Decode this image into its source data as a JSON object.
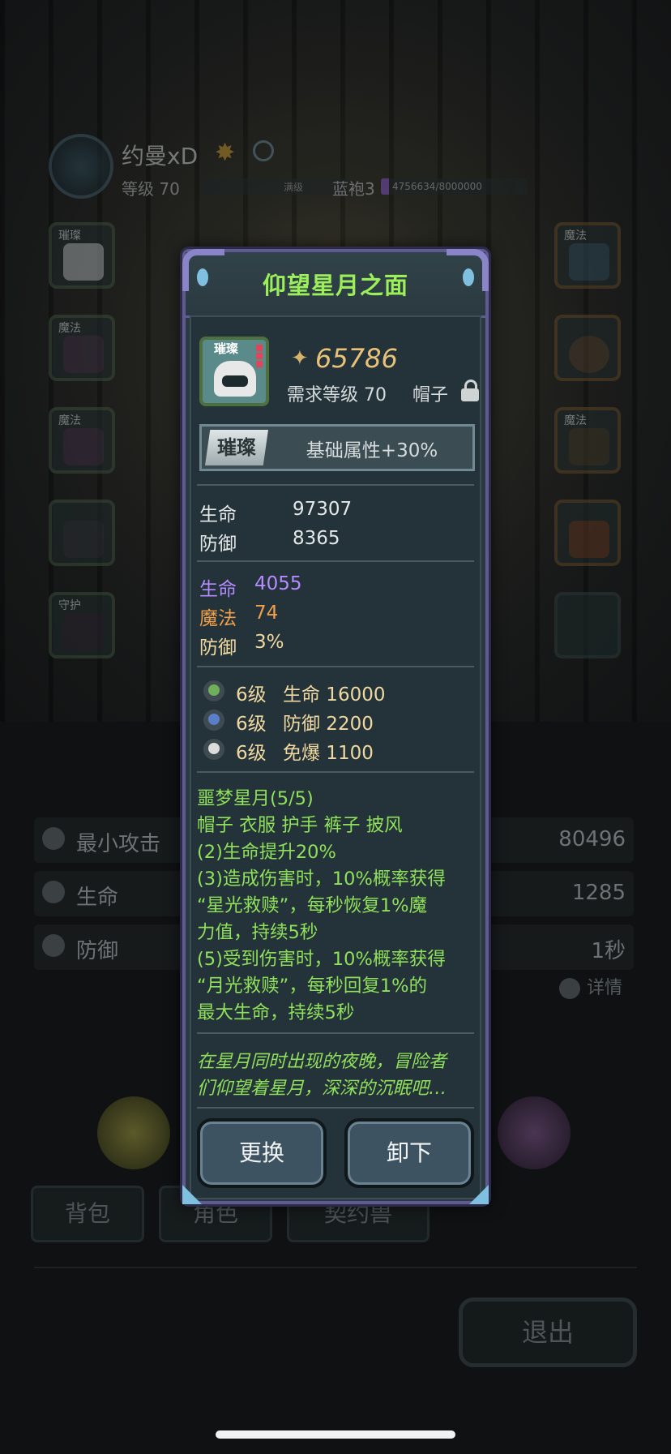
{
  "player": {
    "name": "约曼xD",
    "level_label": "等级 70",
    "level_bar_text": "满级",
    "robe_label": "蓝袍3",
    "robe_progress": "4756634/8000000",
    "robe_progress_value": 0.595
  },
  "slots": {
    "left_tags": [
      "璀璨",
      "魔法",
      "魔法",
      "",
      "守护"
    ],
    "right_tags": [
      "魔法",
      "",
      "魔法",
      "",
      ""
    ]
  },
  "stats": [
    {
      "label": "最小攻击",
      "value": "80496"
    },
    {
      "label": "生命",
      "value": "1285"
    },
    {
      "label": "防御",
      "value": "1秒"
    }
  ],
  "detail_label": "详情",
  "tabs": [
    "背包",
    "角色",
    "契约兽"
  ],
  "exit_label": "退出",
  "modal": {
    "title": "仰望星月之面",
    "item_tag": "璀璨",
    "power": "65786",
    "req_level": "需求等级 70",
    "slot_type": "帽子",
    "rarity_tag": "璀璨",
    "rarity_bonus": "基础属性+30%",
    "base_stats": [
      {
        "label": "生命",
        "value": "97307"
      },
      {
        "label": "防御",
        "value": "8365"
      }
    ],
    "extra_stats": [
      {
        "label": "生命",
        "value": "4055",
        "color": "#b48cff"
      },
      {
        "label": "魔法",
        "value": "74",
        "color": "#f0a04a"
      },
      {
        "label": "防御",
        "value": "3%",
        "color": "#f0d9a0"
      }
    ],
    "gems": [
      {
        "level": "6级",
        "effect": "生命 16000",
        "icon": "green-gem-icon"
      },
      {
        "level": "6级",
        "effect": "防御 2200",
        "icon": "blue-gem-icon"
      },
      {
        "level": "6级",
        "effect": "免爆 1100",
        "icon": "white-gem-icon"
      }
    ],
    "set": {
      "name": "噩梦星月(5/5)",
      "pieces": "帽子 衣服 护手 裤子 披风",
      "lines": [
        "(2)生命提升20%",
        "(3)造成伤害时，10%概率获得",
        "“星光救赎”，每秒恢复1%魔",
        "力值，持续5秒",
        "(5)受到伤害时，10%概率获得",
        "“月光救赎”，每秒回复1%的",
        "最大生命，持续5秒"
      ]
    },
    "flavor": [
      "在星月同时出现的夜晚，冒险者",
      "们仰望着星月，深深的沉眠吧…"
    ],
    "replace_label": "更换",
    "unequip_label": "卸下"
  },
  "colors": {
    "title_green": "#9bef5a",
    "set_green": "#8fe05a",
    "power_gold": "#e9c27a",
    "frame_purple": "#5e5a92"
  }
}
